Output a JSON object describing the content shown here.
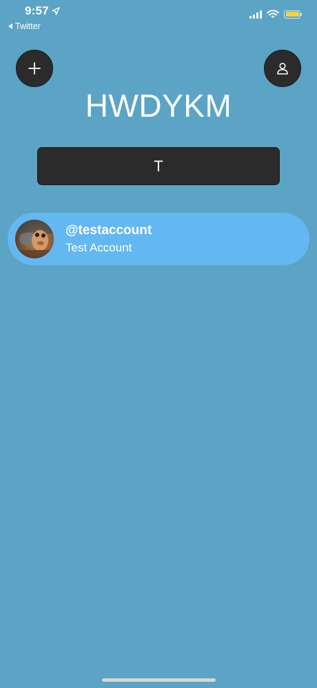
{
  "status_bar": {
    "time": "9:57",
    "back_app_label": "Twitter",
    "icons": [
      "location-arrow-icon",
      "cellular-signal-icon",
      "wifi-icon",
      "battery-icon"
    ],
    "battery_color": "#f5d33f"
  },
  "header": {
    "add_button_icon": "plus-icon",
    "profile_button_icon": "person-icon",
    "title": "HWDYKM"
  },
  "search": {
    "value": "T"
  },
  "results": [
    {
      "handle": "@testaccount",
      "name": "Test Account"
    }
  ],
  "colors": {
    "background": "#5ba4c5",
    "button_dark": "#2b2b2b",
    "result_row": "#63b8f2"
  }
}
